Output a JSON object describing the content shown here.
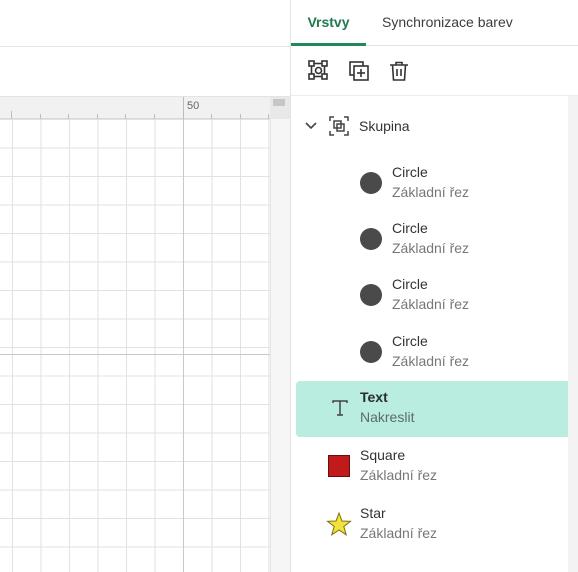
{
  "ruler": {
    "label": "50"
  },
  "tabs": [
    {
      "label": "Vrstvy",
      "active": true
    },
    {
      "label": "Synchronizace barev",
      "active": false
    }
  ],
  "toolbar": {
    "icons": [
      "group-icon",
      "duplicate-icon",
      "trash-icon"
    ]
  },
  "group": {
    "label": "Skupina",
    "expanded": true
  },
  "layers": [
    {
      "name": "Circle",
      "type": "Základní řez",
      "icon": "circle-icon",
      "color": "#4a4a4a"
    },
    {
      "name": "Circle",
      "type": "Základní řez",
      "icon": "circle-icon",
      "color": "#4a4a4a"
    },
    {
      "name": "Circle",
      "type": "Základní řez",
      "icon": "circle-icon",
      "color": "#4a4a4a"
    },
    {
      "name": "Circle",
      "type": "Základní řez",
      "icon": "circle-icon",
      "color": "#4a4a4a"
    },
    {
      "name": "Text",
      "type": "Nakreslit",
      "icon": "text-icon",
      "selected": true
    },
    {
      "name": "Square",
      "type": "Základní řez",
      "icon": "square-icon",
      "color": "#c01a1a"
    },
    {
      "name": "Star",
      "type": "Základní řez",
      "icon": "star-icon",
      "color": "#f2e23a"
    }
  ],
  "colors": {
    "accent": "#1f8a55",
    "selection": "#b9ede0"
  }
}
